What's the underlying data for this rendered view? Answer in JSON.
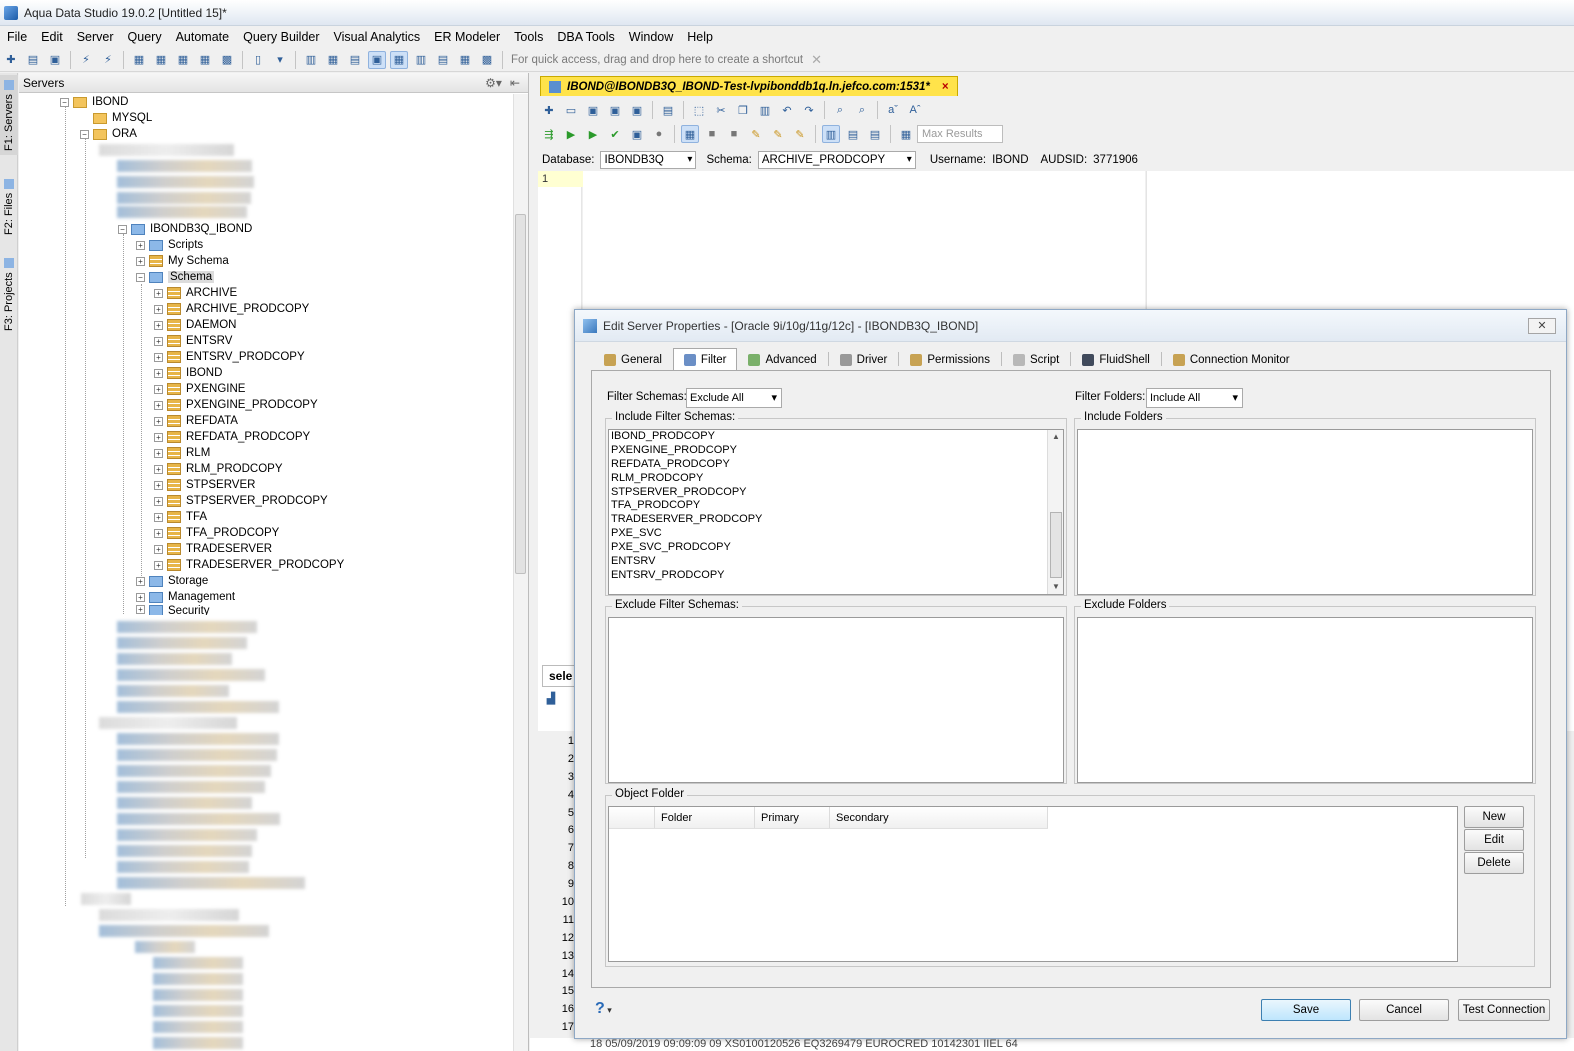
{
  "window": {
    "title": "Aqua Data Studio 19.0.2 [Untitled 15]*"
  },
  "menu": [
    "File",
    "Edit",
    "Server",
    "Query",
    "Automate",
    "Query Builder",
    "Visual Analytics",
    "ER Modeler",
    "Tools",
    "DBA Tools",
    "Window",
    "Help"
  ],
  "toolbar": {
    "hint": "For quick access, drag and drop here to create a shortcut"
  },
  "side_tabs": [
    "F1: Servers",
    "F2: Files",
    "F3: Projects"
  ],
  "servers_panel": {
    "title": "Servers",
    "tree": {
      "root": "IBOND",
      "mysql": "MYSQL",
      "ora": "ORA",
      "connection": "IBONDB3Q_IBOND",
      "scripts": "Scripts",
      "my_schema": "My Schema",
      "schema": "Schema",
      "schemas": [
        "ARCHIVE",
        "ARCHIVE_PRODCOPY",
        "DAEMON",
        "ENTSRV",
        "ENTSRV_PRODCOPY",
        "IBOND",
        "PXENGINE",
        "PXENGINE_PRODCOPY",
        "REFDATA",
        "REFDATA_PRODCOPY",
        "RLM",
        "RLM_PRODCOPY",
        "STPSERVER",
        "STPSERVER_PRODCOPY",
        "TFA",
        "TFA_PRODCOPY",
        "TRADESERVER",
        "TRADESERVER_PRODCOPY"
      ],
      "storage": "Storage",
      "management": "Management",
      "security": "Security"
    }
  },
  "editor": {
    "tab_label": "IBOND@IBONDB3Q_IBOND-Test-lvpibonddb1q.ln.jefco.com:1531*",
    "tab_close": "×",
    "max_results_placeholder": "Max Results",
    "database_label": "Database:",
    "database_value": "IBONDB3Q",
    "schema_label": "Schema:",
    "schema_value": "ARCHIVE_PRODCOPY",
    "username_label": "Username:",
    "username_value": "IBOND",
    "audsid_label": "AUDSID:",
    "audsid_value": "3771906",
    "current_line": "1",
    "results_tab": "sele",
    "result_rows": [
      "1",
      "2",
      "3",
      "4",
      "5",
      "6",
      "7",
      "8",
      "9",
      "10",
      "11",
      "12",
      "13",
      "14",
      "15",
      "16",
      "17"
    ],
    "bottom_row_text": "18     05/09/2019 09:09:09    09      XS0100120526   EQ3269479     EUROCRED            10142301      IIEL                                       64"
  },
  "dialog": {
    "title": "Edit Server Properties - [Oracle 9i/10g/11g/12c] - [IBONDB3Q_IBOND]",
    "close": "✕",
    "tabs": [
      "General",
      "Filter",
      "Advanced",
      "Driver",
      "Permissions",
      "Script",
      "FluidShell",
      "Connection Monitor"
    ],
    "active_tab": "Filter",
    "filter_schemas_label": "Filter Schemas:",
    "filter_schemas_value": "Exclude All",
    "filter_folders_label": "Filter Folders:",
    "filter_folders_value": "Include All",
    "include_schemas_label": "Include Filter Schemas:",
    "include_schemas": [
      "IBOND_PRODCOPY",
      "PXENGINE_PRODCOPY",
      "REFDATA_PRODCOPY",
      "RLM_PRODCOPY",
      "STPSERVER_PRODCOPY",
      "TFA_PRODCOPY",
      "TRADESERVER_PRODCOPY",
      "PXE_SVC",
      "PXE_SVC_PRODCOPY",
      "ENTSRV",
      "ENTSRV_PRODCOPY"
    ],
    "include_folders_label": "Include Folders",
    "exclude_schemas_label": "Exclude Filter Schemas:",
    "exclude_folders_label": "Exclude Folders",
    "object_folder_label": "Object Folder",
    "object_folder_columns": [
      "",
      "Folder",
      "Primary",
      "Secondary"
    ],
    "side_buttons": {
      "new": "New",
      "edit": "Edit",
      "delete": "Delete"
    },
    "help": "?",
    "buttons": {
      "save": "Save",
      "cancel": "Cancel",
      "test": "Test Connection"
    }
  }
}
